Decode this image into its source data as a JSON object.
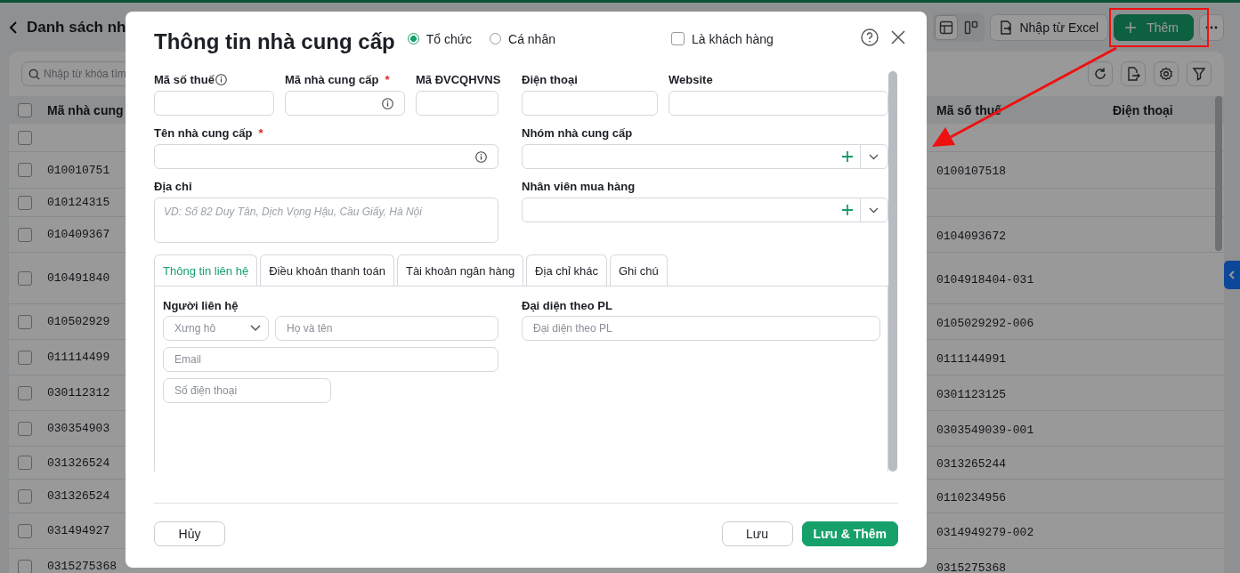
{
  "page": {
    "title": "Danh sách nh",
    "search_placeholder": "Nhập từ khóa tìm",
    "view_modes": [
      {
        "kind": "table",
        "selected": true
      },
      {
        "kind": "board",
        "selected": false
      }
    ],
    "import_button": "Nhập từ Excel",
    "add_button": "Thêm",
    "table": {
      "columns": [
        "Mã nhà cung",
        "Mã số thuế",
        "Điện thoại"
      ],
      "all_checked": false,
      "rows": [
        {
          "checked": false,
          "supplier_code": "",
          "tax_code": ""
        },
        {
          "checked": false,
          "supplier_code": "010010751",
          "tax_code": "0100107518"
        },
        {
          "checked": false,
          "supplier_code": "010124315",
          "tax_code": ""
        },
        {
          "checked": false,
          "supplier_code": "010409367",
          "tax_code": "0104093672"
        },
        {
          "checked": false,
          "supplier_code": "010491840",
          "tax_code": "0104918404-031"
        },
        {
          "checked": false,
          "supplier_code": "010502929",
          "tax_code": "0105029292-006"
        },
        {
          "checked": false,
          "supplier_code": "011114499",
          "tax_code": "0111144991"
        },
        {
          "checked": false,
          "supplier_code": "030112312",
          "tax_code": "0301123125"
        },
        {
          "checked": false,
          "supplier_code": "030354903",
          "tax_code": "0303549039-001"
        },
        {
          "checked": false,
          "supplier_code": "031326524",
          "tax_code": "0313265244"
        },
        {
          "checked": false,
          "supplier_code": "031326524",
          "tax_code": "0110234956"
        },
        {
          "checked": false,
          "supplier_code": "031494927",
          "tax_code": "0314949279-002"
        },
        {
          "checked": false,
          "supplier_code": "0315275368",
          "tax_code": "0315275368"
        }
      ]
    }
  },
  "dialog": {
    "title": "Thông tin nhà cung cấp",
    "entity_types": [
      {
        "label": "Tổ chức",
        "selected": true
      },
      {
        "label": "Cá nhân",
        "selected": false
      }
    ],
    "is_customer": {
      "label": "Là khách hàng",
      "checked": false
    },
    "fields": {
      "tax_code": {
        "label": "Mã số thuế"
      },
      "supplier_code": {
        "label": "Mã nhà cung cấp",
        "required_mark": "*"
      },
      "budget_code": {
        "label": "Mã ĐVCQHVNS"
      },
      "phone": {
        "label": "Điện thoại"
      },
      "website": {
        "label": "Website"
      },
      "name": {
        "label": "Tên nhà cung cấp",
        "required_mark": "*"
      },
      "group": {
        "label": "Nhóm nhà cung cấp"
      },
      "address": {
        "label": "Địa chỉ",
        "placeholder": "VD: Số 82 Duy Tân, Dịch Vọng Hậu, Cầu Giấy, Hà Nội"
      },
      "buyer": {
        "label": "Nhân viên mua hàng"
      }
    },
    "tabs": [
      {
        "label": "Thông tin liên hệ",
        "selected": true
      },
      {
        "label": "Điều khoản thanh toán",
        "selected": false
      },
      {
        "label": "Tài khoản ngân hàng",
        "selected": false
      },
      {
        "label": "Địa chỉ khác",
        "selected": false
      },
      {
        "label": "Ghi chú",
        "selected": false
      }
    ],
    "contact": {
      "label": "Người liên hệ",
      "salutation": {
        "placeholder": "Xưng hô"
      },
      "full_name": {
        "placeholder": "Họ và tên"
      },
      "email": {
        "placeholder": "Email"
      },
      "phone": {
        "placeholder": "Số điện thoại"
      }
    },
    "legal_rep": {
      "label": "Đại diện theo PL",
      "placeholder": "Đại diện theo PL"
    },
    "footer": {
      "cancel": "Hủy",
      "save": "Lưu",
      "save_and_add": "Lưu & Thêm"
    }
  }
}
